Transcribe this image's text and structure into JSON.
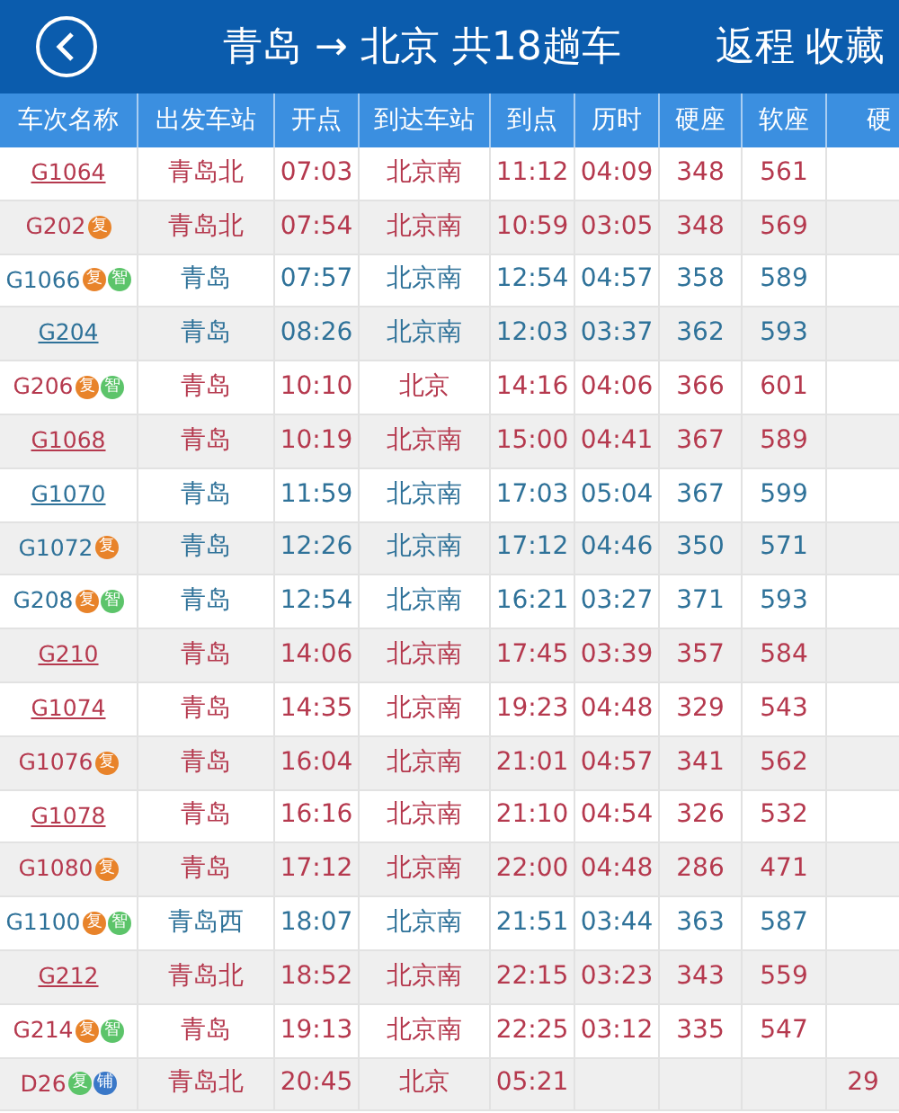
{
  "header": {
    "title": "青岛 → 北京 共18趟车",
    "actions": [
      "返程",
      "收藏"
    ]
  },
  "table": {
    "columns": [
      "车次名称",
      "出发车站",
      "开点",
      "到达车站",
      "到点",
      "历时",
      "硬座",
      "软座",
      "硬"
    ],
    "rows": [
      {
        "linked": true,
        "badges": [],
        "color": "#b5394e",
        "cells": [
          "G1064",
          "青岛北",
          "07:03",
          "北京南",
          "11:12",
          "04:09",
          "348",
          "561",
          ""
        ]
      },
      {
        "linked": false,
        "badges": [
          {
            "label": "复",
            "color": "#e8832a"
          }
        ],
        "color": "#b5394e",
        "cells": [
          "G202",
          "青岛北",
          "07:54",
          "北京南",
          "10:59",
          "03:05",
          "348",
          "569",
          ""
        ]
      },
      {
        "linked": false,
        "badges": [
          {
            "label": "复",
            "color": "#e8832a"
          },
          {
            "label": "智",
            "color": "#5cc46a"
          }
        ],
        "color": "#2f7299",
        "cells": [
          "G1066",
          "青岛",
          "07:57",
          "北京南",
          "12:54",
          "04:57",
          "358",
          "589",
          ""
        ]
      },
      {
        "linked": true,
        "badges": [],
        "color": "#2f7299",
        "cells": [
          "G204",
          "青岛",
          "08:26",
          "北京南",
          "12:03",
          "03:37",
          "362",
          "593",
          ""
        ]
      },
      {
        "linked": false,
        "badges": [
          {
            "label": "复",
            "color": "#e8832a"
          },
          {
            "label": "智",
            "color": "#5cc46a"
          }
        ],
        "color": "#b5394e",
        "cells": [
          "G206",
          "青岛",
          "10:10",
          "北京",
          "14:16",
          "04:06",
          "366",
          "601",
          ""
        ]
      },
      {
        "linked": true,
        "badges": [],
        "color": "#b5394e",
        "cells": [
          "G1068",
          "青岛",
          "10:19",
          "北京南",
          "15:00",
          "04:41",
          "367",
          "589",
          ""
        ]
      },
      {
        "linked": true,
        "badges": [],
        "color": "#2f7299",
        "cells": [
          "G1070",
          "青岛",
          "11:59",
          "北京南",
          "17:03",
          "05:04",
          "367",
          "599",
          ""
        ]
      },
      {
        "linked": false,
        "badges": [
          {
            "label": "复",
            "color": "#e8832a"
          }
        ],
        "color": "#2f7299",
        "cells": [
          "G1072",
          "青岛",
          "12:26",
          "北京南",
          "17:12",
          "04:46",
          "350",
          "571",
          ""
        ]
      },
      {
        "linked": false,
        "badges": [
          {
            "label": "复",
            "color": "#e8832a"
          },
          {
            "label": "智",
            "color": "#5cc46a"
          }
        ],
        "color": "#2f7299",
        "cells": [
          "G208",
          "青岛",
          "12:54",
          "北京南",
          "16:21",
          "03:27",
          "371",
          "593",
          ""
        ]
      },
      {
        "linked": true,
        "badges": [],
        "color": "#b5394e",
        "cells": [
          "G210",
          "青岛",
          "14:06",
          "北京南",
          "17:45",
          "03:39",
          "357",
          "584",
          ""
        ]
      },
      {
        "linked": true,
        "badges": [],
        "color": "#b5394e",
        "cells": [
          "G1074",
          "青岛",
          "14:35",
          "北京南",
          "19:23",
          "04:48",
          "329",
          "543",
          ""
        ]
      },
      {
        "linked": false,
        "badges": [
          {
            "label": "复",
            "color": "#e8832a"
          }
        ],
        "color": "#b5394e",
        "cells": [
          "G1076",
          "青岛",
          "16:04",
          "北京南",
          "21:01",
          "04:57",
          "341",
          "562",
          ""
        ]
      },
      {
        "linked": true,
        "badges": [],
        "color": "#b5394e",
        "cells": [
          "G1078",
          "青岛",
          "16:16",
          "北京南",
          "21:10",
          "04:54",
          "326",
          "532",
          ""
        ]
      },
      {
        "linked": false,
        "badges": [
          {
            "label": "复",
            "color": "#e8832a"
          }
        ],
        "color": "#b5394e",
        "cells": [
          "G1080",
          "青岛",
          "17:12",
          "北京南",
          "22:00",
          "04:48",
          "286",
          "471",
          ""
        ]
      },
      {
        "linked": false,
        "badges": [
          {
            "label": "复",
            "color": "#e8832a"
          },
          {
            "label": "智",
            "color": "#5cc46a"
          }
        ],
        "color": "#2f7299",
        "cells": [
          "G1100",
          "青岛西",
          "18:07",
          "北京南",
          "21:51",
          "03:44",
          "363",
          "587",
          ""
        ]
      },
      {
        "linked": true,
        "badges": [],
        "color": "#b5394e",
        "cells": [
          "G212",
          "青岛北",
          "18:52",
          "北京南",
          "22:15",
          "03:23",
          "343",
          "559",
          ""
        ]
      },
      {
        "linked": false,
        "badges": [
          {
            "label": "复",
            "color": "#e8832a"
          },
          {
            "label": "智",
            "color": "#5cc46a"
          }
        ],
        "color": "#b5394e",
        "cells": [
          "G214",
          "青岛",
          "19:13",
          "北京南",
          "22:25",
          "03:12",
          "335",
          "547",
          ""
        ]
      },
      {
        "linked": false,
        "badges": [
          {
            "label": "复",
            "color": "#5cc46a"
          },
          {
            "label": "铺",
            "color": "#3a78c8"
          }
        ],
        "color": "#b5394e",
        "cells": [
          "D26",
          "青岛北",
          "20:45",
          "北京",
          "05:21",
          "",
          "",
          "",
          "29"
        ]
      }
    ]
  }
}
